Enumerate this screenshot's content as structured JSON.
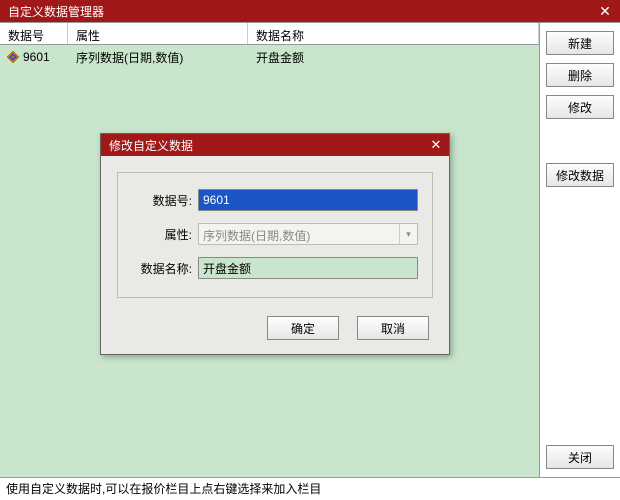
{
  "window": {
    "title": "自定义数据管理器"
  },
  "table": {
    "headers": {
      "id": "数据号",
      "attr": "属性",
      "name": "数据名称"
    },
    "rows": [
      {
        "id": "9601",
        "attr": "序列数据(日期,数值)",
        "name": "开盘金额"
      }
    ]
  },
  "buttons": {
    "new": "新建",
    "delete": "删除",
    "modify": "修改",
    "modify_data": "修改数据",
    "close": "关闭"
  },
  "statusbar": "使用自定义数据时,可以在报价栏目上点右键选择来加入栏目",
  "dialog": {
    "title": "修改自定义数据",
    "labels": {
      "id": "数据号:",
      "attr": "属性:",
      "name": "数据名称:"
    },
    "values": {
      "id": "9601",
      "attr": "序列数据(日期,数值)",
      "name": "开盘金额"
    },
    "ok": "确定",
    "cancel": "取消"
  }
}
